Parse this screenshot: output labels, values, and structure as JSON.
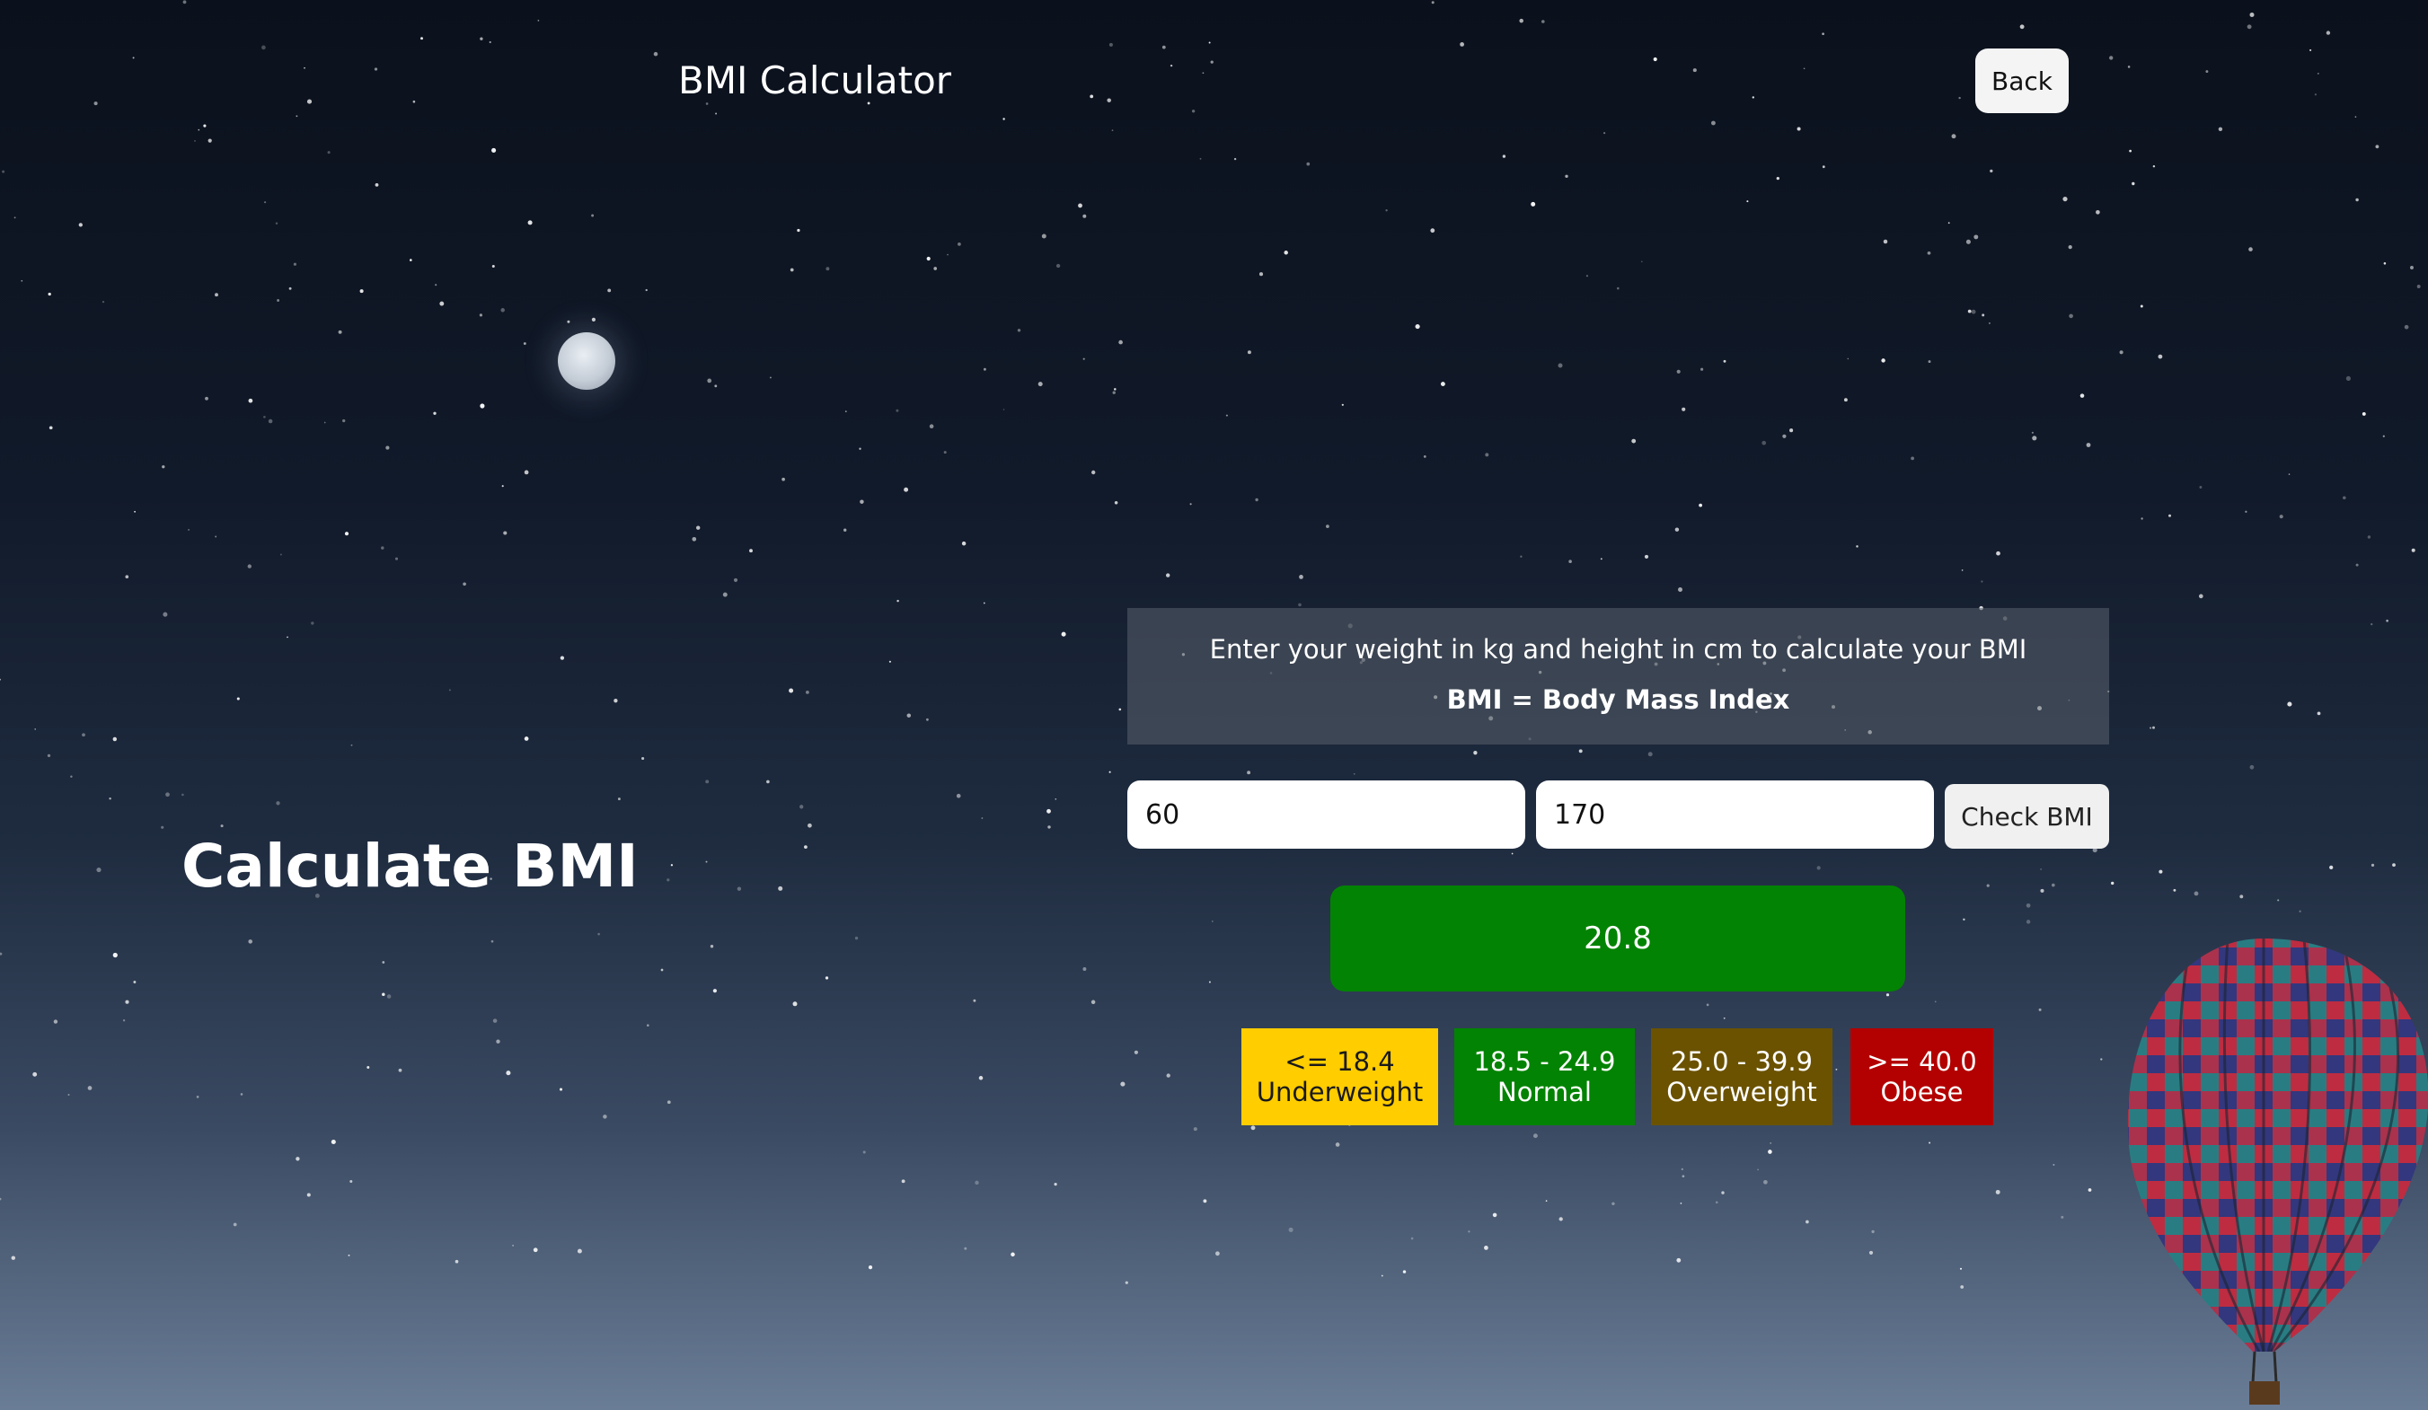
{
  "header": {
    "title": "BMI Calculator",
    "back_label": "Back"
  },
  "hero": {
    "heading": "Calculate BMI"
  },
  "info": {
    "instructions": "Enter your weight in kg and height in cm to calculate your BMI",
    "definition": "BMI = Body Mass Index"
  },
  "form": {
    "weight_value": "60",
    "height_value": "170",
    "check_label": "Check BMI"
  },
  "result": {
    "value": "20.8",
    "color": "#038303"
  },
  "legend": [
    {
      "range": "<= 18.4",
      "label": "Underweight",
      "color": "#ffcd00"
    },
    {
      "range": "18.5 - 24.9",
      "label": "Normal",
      "color": "#038303"
    },
    {
      "range": "25.0 - 39.9",
      "label": "Overweight",
      "color": "#6b5200"
    },
    {
      "range": ">= 40.0",
      "label": "Obese",
      "color": "#b30000"
    }
  ],
  "background": {
    "decorations": [
      "moon",
      "stars",
      "hot-air-balloon"
    ]
  }
}
